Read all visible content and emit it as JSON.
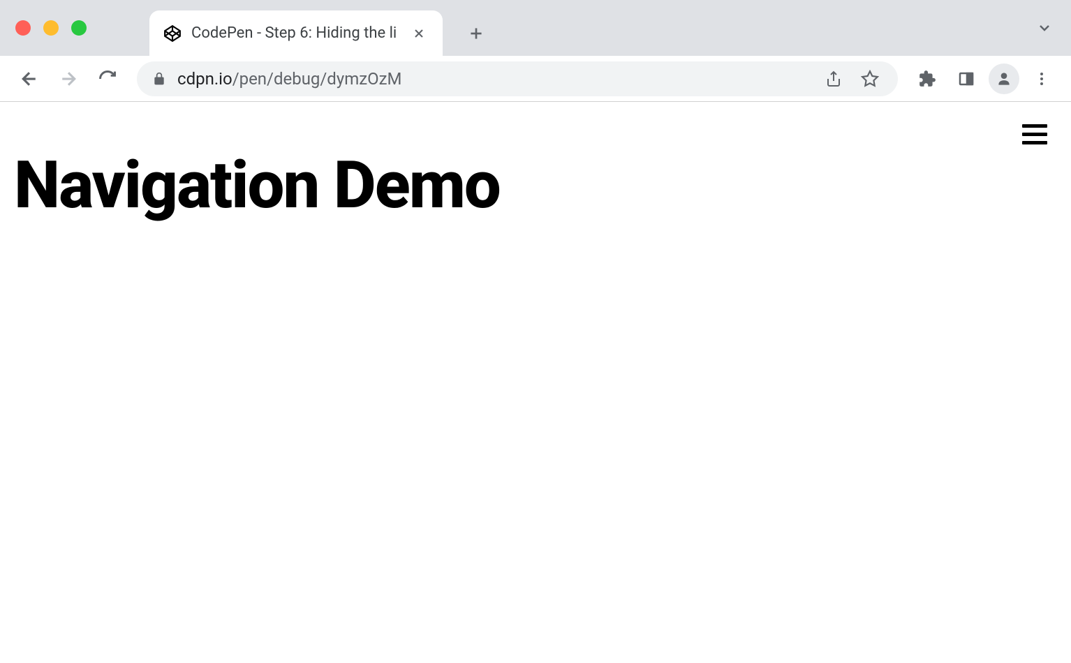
{
  "browser": {
    "tab": {
      "title": "CodePen - Step 6: Hiding the li",
      "favicon": "codepen-icon"
    },
    "url": {
      "domain": "cdpn.io",
      "path": "/pen/debug/dymzOzM"
    }
  },
  "page": {
    "heading": "Navigation Demo"
  }
}
